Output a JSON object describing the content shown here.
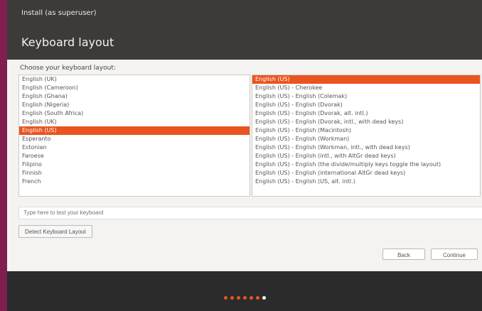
{
  "window": {
    "title": "Install (as superuser)"
  },
  "page_title": "Keyboard layout",
  "prompt": "Choose your keyboard layout:",
  "layouts": [
    "English (UK)",
    "English (Cameroon)",
    "English (Ghana)",
    "English (Nigeria)",
    "English (South Africa)",
    "English (UK)",
    "English (US)",
    "Esperanto",
    "Estonian",
    "Faroese",
    "Filipino",
    "Finnish",
    "French"
  ],
  "selected_layout": "English (US)",
  "variants": [
    "English (US)",
    "English (US) - Cherokee",
    "English (US) - English (Colemak)",
    "English (US) - English (Dvorak)",
    "English (US) - English (Dvorak, alt. intl.)",
    "English (US) - English (Dvorak, intl., with dead keys)",
    "English (US) - English (Macintosh)",
    "English (US) - English (Workman)",
    "English (US) - English (Workman, intl., with dead keys)",
    "English (US) - English (intl., with AltGr dead keys)",
    "English (US) - English (the divide/multiply keys toggle the layout)",
    "English (US) - English (international AltGr dead keys)",
    "English (US) - English (US, alt. intl.)"
  ],
  "selected_variant": "English (US)",
  "search": {
    "placeholder": "Type here to test your keyboard"
  },
  "detect_button": "Detect Keyboard Layout",
  "back_button": "Back",
  "continue_button": "Continue",
  "progress_steps": [
    {
      "active": false
    },
    {
      "active": false
    },
    {
      "active": false
    },
    {
      "active": false
    },
    {
      "active": false
    },
    {
      "active": false
    },
    {
      "active": true
    }
  ]
}
